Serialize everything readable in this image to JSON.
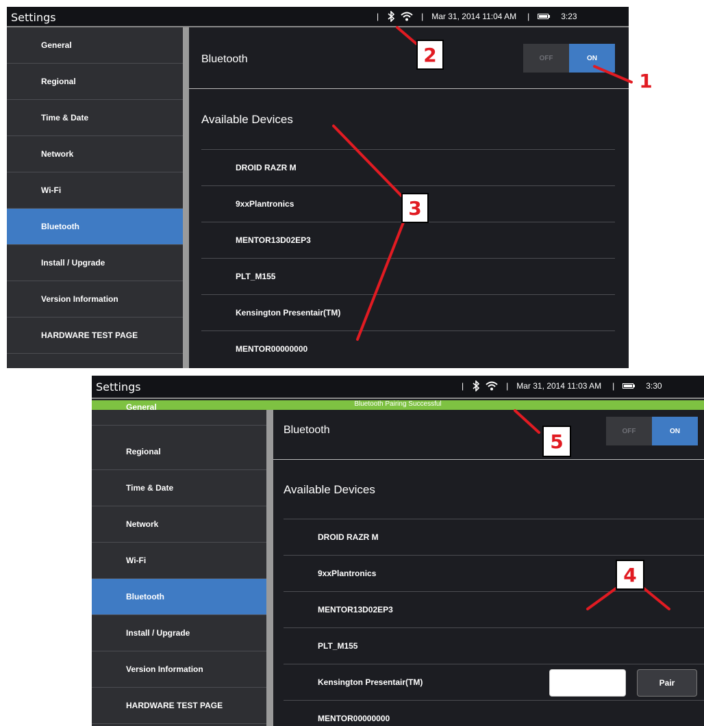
{
  "shot1": {
    "title": "Settings",
    "status": {
      "datetime": "Mar 31, 2014  11:04 AM",
      "battery_time": "3:23",
      "sep": "|"
    },
    "sidebar": [
      {
        "label": "General"
      },
      {
        "label": "Regional"
      },
      {
        "label": "Time & Date"
      },
      {
        "label": "Network"
      },
      {
        "label": "Wi-Fi"
      },
      {
        "label": "Bluetooth",
        "active": true
      },
      {
        "label": "Install / Upgrade"
      },
      {
        "label": "Version Information"
      },
      {
        "label": "HARDWARE TEST PAGE"
      }
    ],
    "bluetooth_label": "Bluetooth",
    "toggle": {
      "off": "OFF",
      "on": "ON",
      "state": "ON"
    },
    "available_title": "Available Devices",
    "devices": [
      "DROID RAZR M",
      "9xxPlantronics",
      "MENTOR13D02EP3",
      "PLT_M155",
      "Kensington Presentair(TM)",
      "MENTOR00000000"
    ]
  },
  "shot2": {
    "title": "Settings",
    "status": {
      "datetime": "Mar 31, 2014  11:03 AM",
      "battery_time": "3:30",
      "sep": "|"
    },
    "banner": "Bluetooth Pairing Successful",
    "sidebar": [
      {
        "label": "General"
      },
      {
        "label": "Regional"
      },
      {
        "label": "Time & Date"
      },
      {
        "label": "Network"
      },
      {
        "label": "Wi-Fi"
      },
      {
        "label": "Bluetooth",
        "active": true
      },
      {
        "label": "Install / Upgrade"
      },
      {
        "label": "Version Information"
      },
      {
        "label": "HARDWARE TEST PAGE"
      }
    ],
    "bluetooth_label": "Bluetooth",
    "toggle": {
      "off": "OFF",
      "on": "ON",
      "state": "ON"
    },
    "available_title": "Available Devices",
    "devices": [
      "DROID RAZR M",
      "9xxPlantronics",
      "MENTOR13D02EP3",
      "PLT_M155",
      "Kensington Presentair(TM)",
      "MENTOR00000000"
    ],
    "pair_button": "Pair",
    "pin_value": ""
  },
  "callouts": {
    "c1": "1",
    "c2": "2",
    "c3": "3",
    "c4": "4",
    "c5": "5"
  },
  "colors": {
    "accent": "#3f7bc4",
    "banner": "#7ec242",
    "callout": "#e11b22"
  },
  "icons": [
    "bluetooth-icon",
    "wifi-icon",
    "battery-icon"
  ]
}
